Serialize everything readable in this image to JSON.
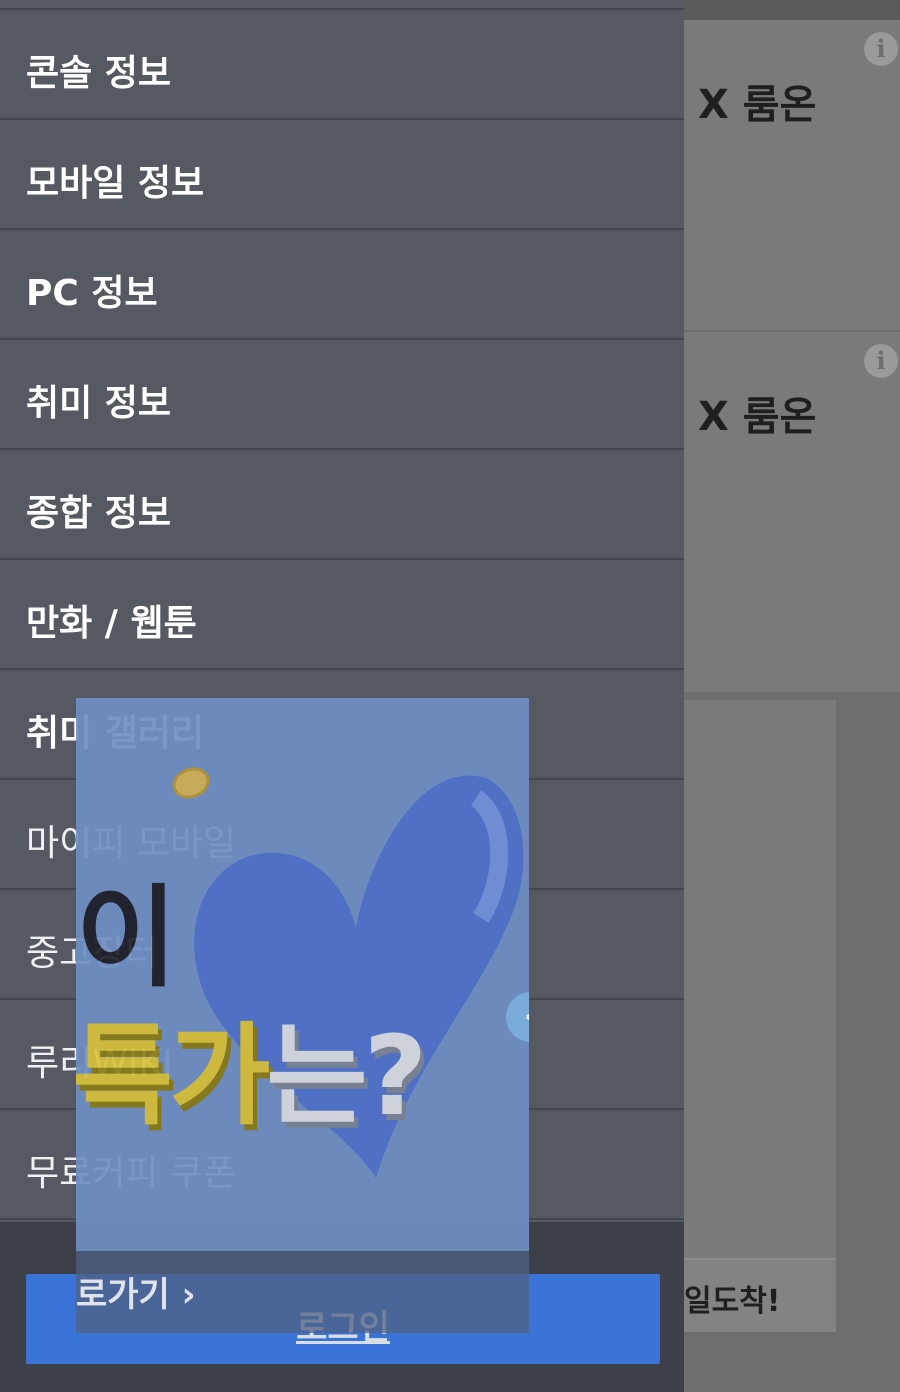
{
  "background": {
    "card_titles": [
      "X 룸온",
      "X 룸온"
    ],
    "info_icon": "i",
    "bottom_text": "일도착!"
  },
  "menu": {
    "items": [
      {
        "label": "콘솔 정보",
        "weight": "bold"
      },
      {
        "label": "모바일 정보",
        "weight": "bold"
      },
      {
        "label": "PC 정보",
        "weight": "bold"
      },
      {
        "label": "취미 정보",
        "weight": "bold"
      },
      {
        "label": "종합 정보",
        "weight": "bold"
      },
      {
        "label": "만화 / 웹툰",
        "weight": "bold"
      },
      {
        "label": "취미 갤러리",
        "weight": "bold"
      },
      {
        "label": "마이피 모바일",
        "weight": "regular"
      },
      {
        "label": "중고장터",
        "weight": "regular"
      },
      {
        "label": "루리WIKI",
        "weight": "regular"
      },
      {
        "label": "무료커피 쿠폰",
        "weight": "regular"
      }
    ]
  },
  "footer": {
    "login_label": "로그인"
  },
  "ad": {
    "partial_top": "이",
    "big_yellow": "특가",
    "big_white": "는?",
    "arrow": "‹",
    "bottom_text": "로가기 ›"
  },
  "colors": {
    "drawer_bg": "#555962",
    "login_button": "#3a73d6",
    "ad_bg": "#6f8fc4"
  }
}
